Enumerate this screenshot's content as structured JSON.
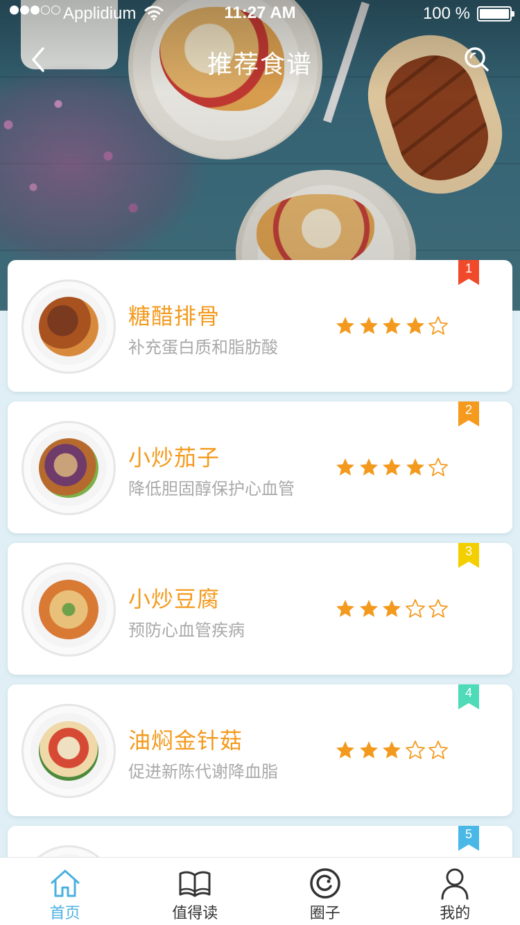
{
  "status_bar": {
    "carrier": "Applidium",
    "time": "11:27 AM",
    "battery": "100 %",
    "signal_bars_on": 3,
    "signal_bars_total": 5
  },
  "header": {
    "title": "推荐食谱",
    "back_icon": "chevron-left-icon",
    "search_icon": "search-icon"
  },
  "colors": {
    "accent": "#f39a1e",
    "star": "#f39a1e",
    "tab_active": "#4ab0e0",
    "rank_1": "#f04a2b",
    "rank_2": "#f59a1d",
    "rank_3": "#f4cf00",
    "rank_4": "#4fdbb8",
    "rank_5": "#4ab8e6"
  },
  "recipes": [
    {
      "rank": "1",
      "name": "糖醋排骨",
      "desc": "补充蛋白质和脂肪酸",
      "rating": 4,
      "max_rating": 5
    },
    {
      "rank": "2",
      "name": "小炒茄子",
      "desc": "降低胆固醇保护心血管",
      "rating": 4,
      "max_rating": 5
    },
    {
      "rank": "3",
      "name": "小炒豆腐",
      "desc": "预防心血管疾病",
      "rating": 3,
      "max_rating": 5
    },
    {
      "rank": "4",
      "name": "油焖金针菇",
      "desc": "促进新陈代谢降血脂",
      "rating": 3,
      "max_rating": 5
    },
    {
      "rank": "5",
      "name": "",
      "desc": "",
      "rating": 0,
      "max_rating": 0
    }
  ],
  "tabs": [
    {
      "label": "首页",
      "icon": "home-icon",
      "active": true
    },
    {
      "label": "值得读",
      "icon": "book-icon",
      "active": false
    },
    {
      "label": "圈子",
      "icon": "circle-icon",
      "active": false
    },
    {
      "label": "我的",
      "icon": "user-icon",
      "active": false
    }
  ]
}
